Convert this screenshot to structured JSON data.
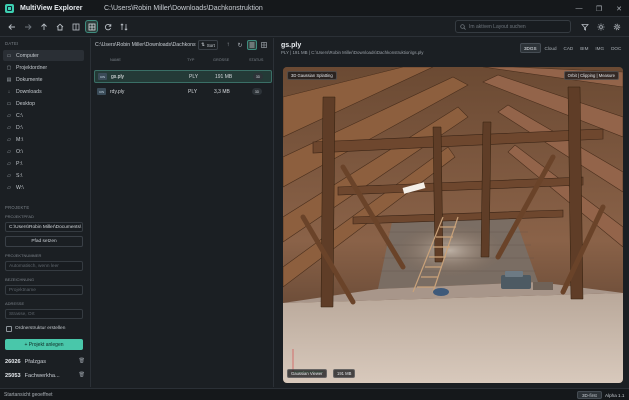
{
  "app": {
    "title": "MultiView Explorer",
    "path": "C:\\Users\\Robin Miller\\Downloads\\Dachkonstruktion"
  },
  "window_controls": [
    "—",
    "❐",
    "✕"
  ],
  "toolbar": {
    "search_placeholder": "Im aktiven Layout suchen"
  },
  "sidebar": {
    "section_data": "DATEI",
    "items": [
      {
        "label": "Computer",
        "icon": "computer-icon"
      },
      {
        "label": "Projektordner",
        "icon": "folder-icon"
      },
      {
        "label": "Dokumente",
        "icon": "document-icon"
      },
      {
        "label": "Downloads",
        "icon": "download-icon"
      },
      {
        "label": "Desktop",
        "icon": "desktop-icon"
      },
      {
        "label": "C:\\",
        "icon": "drive-icon"
      },
      {
        "label": "D:\\",
        "icon": "drive-icon"
      },
      {
        "label": "M:\\",
        "icon": "drive-icon"
      },
      {
        "label": "O:\\",
        "icon": "drive-icon"
      },
      {
        "label": "P:\\",
        "icon": "drive-icon"
      },
      {
        "label": "S:\\",
        "icon": "drive-icon"
      },
      {
        "label": "W:\\",
        "icon": "drive-icon"
      }
    ],
    "selected_item": "Computer",
    "section_projects": "PROJEKTE",
    "projektpfad_label": "PROJEKTPFAD",
    "projektpfad_value": "C:\\Users\\Robin Miller\\Documents\\",
    "pfad_setzen": "Pfad setzen",
    "projektnummer_label": "PROJEKTNUMMER",
    "projektnummer_placeholder": "Automatisch, wenn leer",
    "bezeichnung_label": "BEZEICHNUNG",
    "bezeichnung_placeholder": "Projektname",
    "adresse_label": "ADRESSE",
    "adresse_placeholder": "Strasse, Ort",
    "checkbox_label": "Ordnerstruktur erstellen",
    "create_button": "+ Projekt anlegen",
    "projects": [
      {
        "number": "26026",
        "name": "Pfalzgas"
      },
      {
        "number": "25053",
        "name": "Fachwerkha..."
      }
    ]
  },
  "file_panel": {
    "path": "C:\\Users\\Robin Miller\\Downloads\\Dachkonstruktion",
    "sort_label": "Sort",
    "columns": {
      "name": "NAME",
      "type": "TYP",
      "size": "GRÖSSE",
      "status": "STATUS"
    },
    "rows": [
      {
        "icon": "ply-file-icon",
        "name": "gs.ply",
        "type": "PLY",
        "size": "191 MB",
        "status": "3D"
      },
      {
        "icon": "ply-file-icon",
        "name": "rdy.ply",
        "type": "PLY",
        "size": "3,3 MB",
        "status": "3D"
      }
    ]
  },
  "viewer": {
    "title": "gs.ply",
    "subtitle": "PLY | 191 MB | C:\\Users\\Robin Miller\\Downloads\\Dachkonstruktion\\gs.ply",
    "tabs": [
      "3DGS",
      "Cloud",
      "CAD",
      "BIM",
      "IMG",
      "DOC"
    ],
    "active_tab": "3DGS",
    "overlay_mode": "3D Gaussian Splatting",
    "overlay_controls": "Orbit | Clipping | Measure",
    "overlay_bottom_label": "Gaussian Viewer",
    "overlay_bottom_size": "191 MB"
  },
  "status": {
    "text": "Startansicht geoeffnet",
    "mode_badge": "3D-first",
    "version": "Alpha 1.1"
  },
  "colors": {
    "accent": "#49c7aa",
    "background": "#1b1f23",
    "titlebar": "#15181b"
  }
}
